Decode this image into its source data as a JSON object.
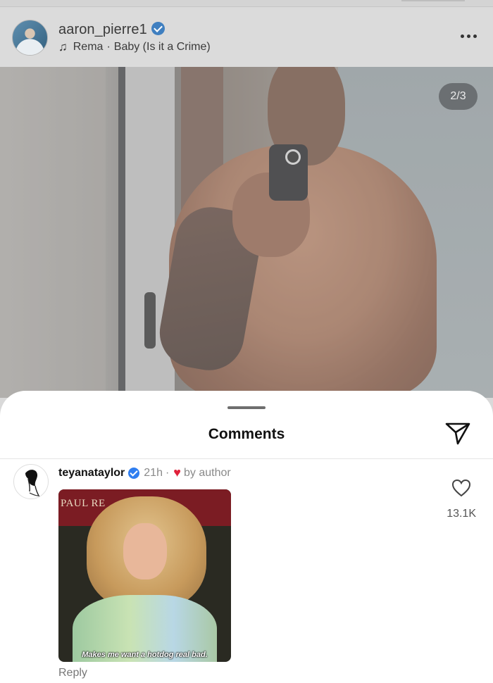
{
  "post": {
    "username": "aaron_pierre1",
    "artist": "Rema",
    "song": "Baby (Is it a Crime)",
    "separator": "·",
    "carousel_counter": "2/3",
    "icons": {
      "verified": "verified-badge-icon",
      "music": "music-note-icon",
      "more": "more-options-icon"
    }
  },
  "comments_sheet": {
    "title": "Comments",
    "share_icon": "send-icon"
  },
  "comments": [
    {
      "username": "teyanataylor",
      "verified": true,
      "time": "21h",
      "separator": "·",
      "liked_by_author_label": "by author",
      "gif": {
        "sign_text": "PAUL RE",
        "caption": "Makes me want a hotdog real bad."
      },
      "reply_label": "Reply",
      "like_count": "13.1K"
    }
  ],
  "colors": {
    "verified_blue": "#2f7ef0",
    "heart_red": "#e0203a"
  }
}
